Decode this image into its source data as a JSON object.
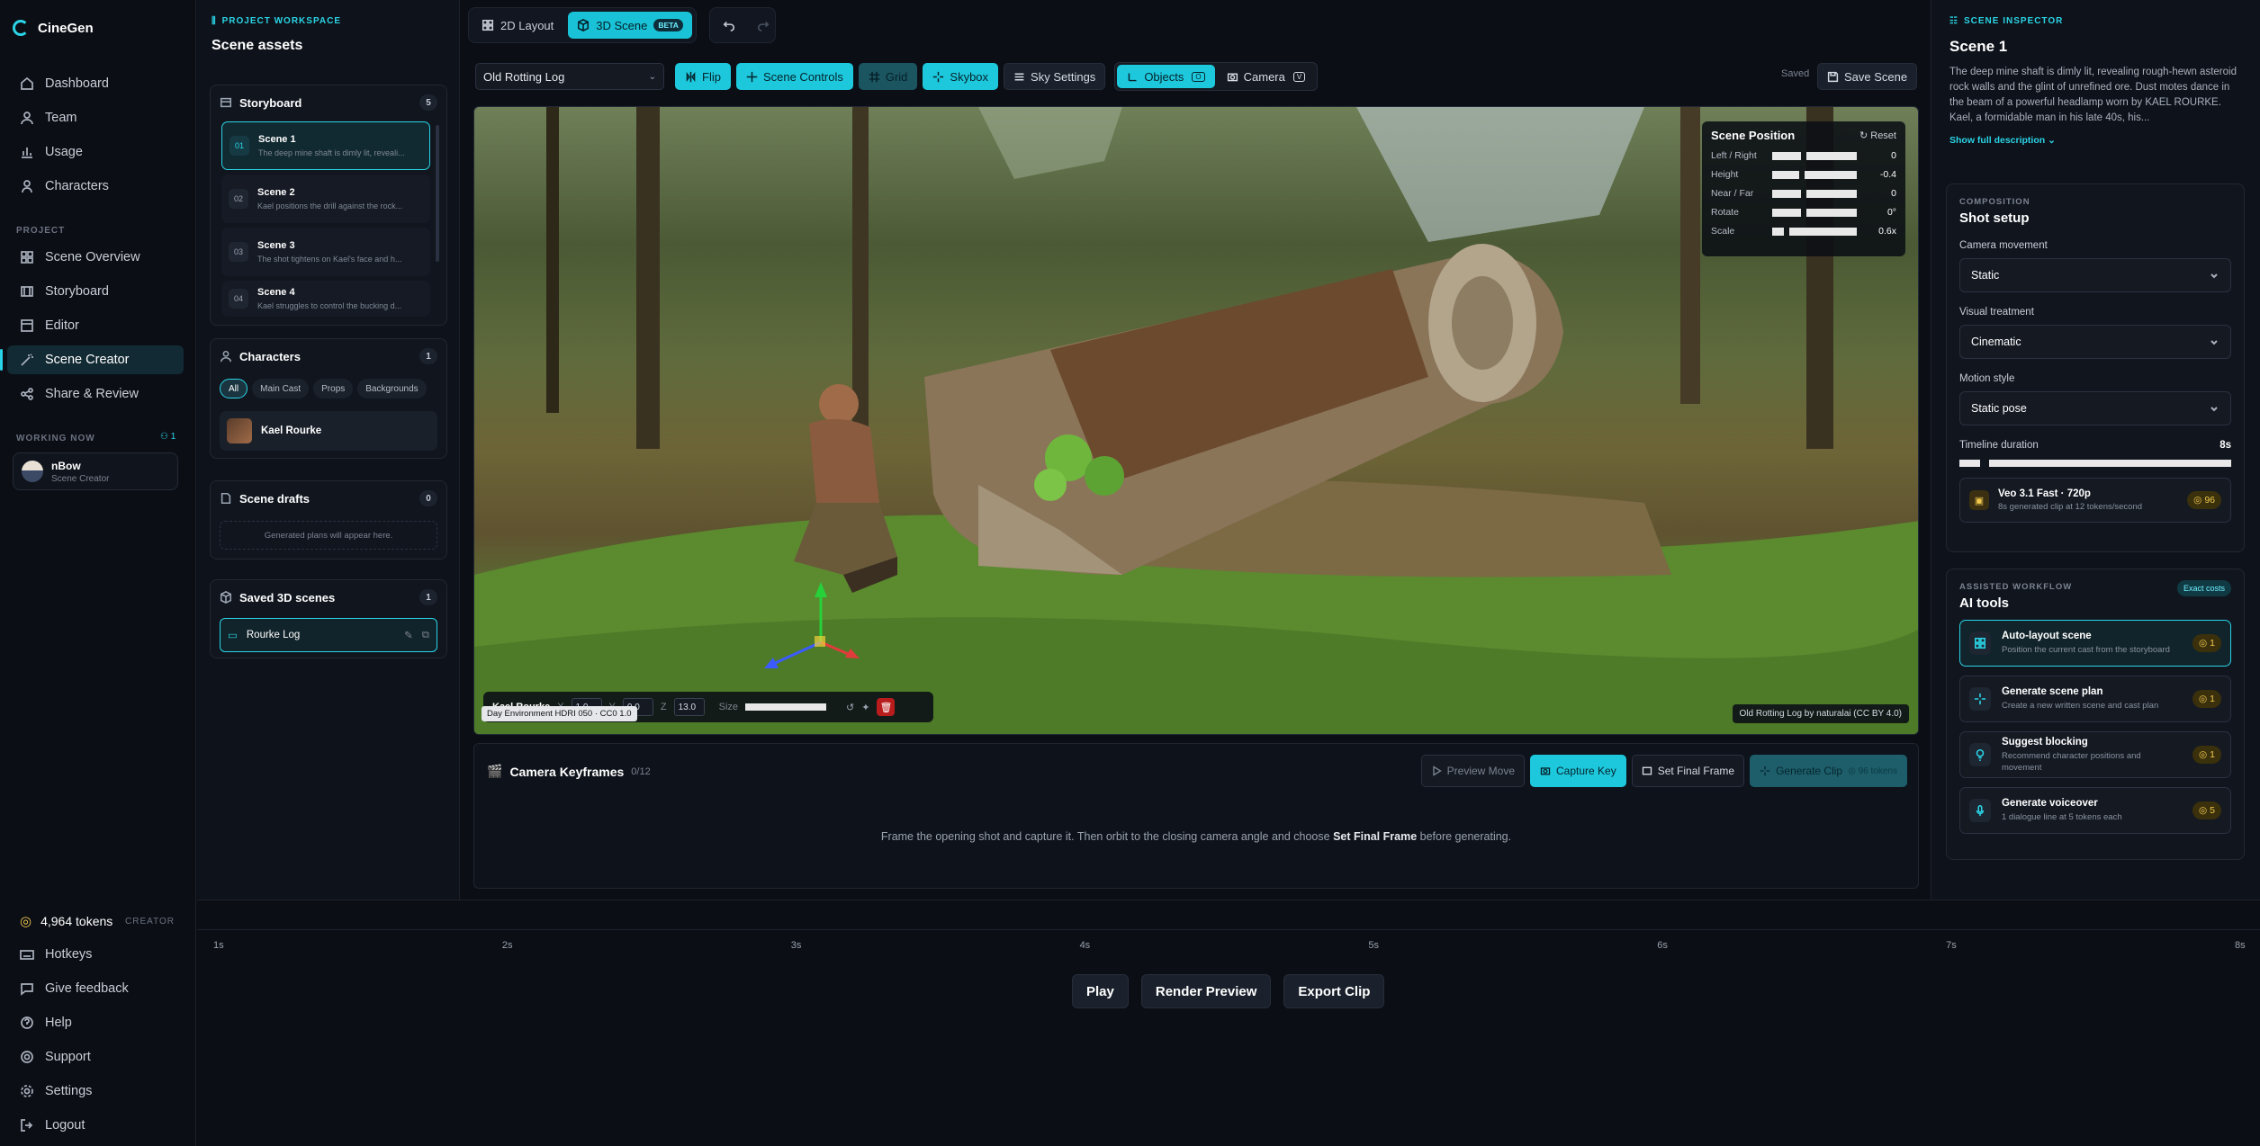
{
  "app": {
    "name": "CineGen"
  },
  "nav": {
    "items": [
      {
        "label": "Dashboard",
        "icon": "home-icon"
      },
      {
        "label": "Team",
        "icon": "users-icon"
      },
      {
        "label": "Usage",
        "icon": "chart-icon"
      },
      {
        "label": "Characters",
        "icon": "user-icon"
      }
    ],
    "project_label": "PROJECT",
    "project_items": [
      {
        "label": "Scene Overview",
        "icon": "grid-icon"
      },
      {
        "label": "Storyboard",
        "icon": "film-icon"
      },
      {
        "label": "Editor",
        "icon": "edit-icon"
      },
      {
        "label": "Scene Creator",
        "icon": "wand-icon"
      },
      {
        "label": "Share & Review",
        "icon": "share-icon"
      }
    ],
    "working_now_label": "WORKING NOW",
    "working_count": "1",
    "user": {
      "name": "nBow",
      "role": "Scene Creator"
    },
    "tokens": "4,964 tokens",
    "tier": "CREATOR",
    "footer_items": [
      {
        "label": "Hotkeys",
        "icon": "keyboard-icon"
      },
      {
        "label": "Give feedback",
        "icon": "message-icon"
      },
      {
        "label": "Help",
        "icon": "help-icon"
      },
      {
        "label": "Support",
        "icon": "support-icon"
      },
      {
        "label": "Settings",
        "icon": "gear-icon"
      },
      {
        "label": "Logout",
        "icon": "logout-icon"
      }
    ]
  },
  "assets": {
    "eyebrow": "PROJECT WORKSPACE",
    "title": "Scene assets",
    "storyboard": {
      "title": "Storyboard",
      "count": "5",
      "scenes": [
        {
          "num": "01",
          "title": "Scene 1",
          "desc": "The deep mine shaft is dimly lit, reveali..."
        },
        {
          "num": "02",
          "title": "Scene 2",
          "desc": "Kael positions the drill against the rock..."
        },
        {
          "num": "03",
          "title": "Scene 3",
          "desc": "The shot tightens on Kael's face and h..."
        },
        {
          "num": "04",
          "title": "Scene 4",
          "desc": "Kael struggles to control the bucking d..."
        }
      ]
    },
    "characters": {
      "title": "Characters",
      "count": "1",
      "filters": [
        "All",
        "Main Cast",
        "Props",
        "Backgrounds"
      ],
      "items": [
        {
          "name": "Kael Rourke"
        }
      ]
    },
    "drafts": {
      "title": "Scene drafts",
      "count": "0",
      "empty": "Generated plans will appear here."
    },
    "saved": {
      "title": "Saved 3D scenes",
      "count": "1",
      "items": [
        {
          "name": "Rourke Log"
        }
      ]
    }
  },
  "topbar": {
    "layout2d": "2D Layout",
    "scene3d": "3D Scene",
    "beta": "BETA"
  },
  "toolbar": {
    "object_select": "Old Rotting Log",
    "flip": "Flip",
    "scene_controls": "Scene Controls",
    "grid": "Grid",
    "skybox": "Skybox",
    "sky_settings": "Sky Settings",
    "objects": "Objects",
    "objects_key": "O",
    "camera": "Camera",
    "camera_key": "V",
    "saved": "Saved",
    "save_scene": "Save Scene"
  },
  "viewport": {
    "position_panel": {
      "title": "Scene Position",
      "reset": "Reset",
      "rows": [
        {
          "label": "Left / Right",
          "value": "0",
          "fill": 0.5
        },
        {
          "label": "Height",
          "value": "-0.4",
          "fill": 0.45
        },
        {
          "label": "Near / Far",
          "value": "0",
          "fill": 0.5
        },
        {
          "label": "Rotate",
          "value": "0°",
          "fill": 0.5
        },
        {
          "label": "Scale",
          "value": "0.6x",
          "fill": 0.06
        }
      ]
    },
    "selection": {
      "name": "Kael Rourke",
      "x_label": "X",
      "x": "1.0",
      "y_label": "Y",
      "y": "0.0",
      "z_label": "Z",
      "z": "13.0",
      "size_label": "Size"
    },
    "tooltip": "Day Environment HDRI 050 · CC0 1.0",
    "credit": "Old Rotting Log by naturalai (CC BY 4.0)"
  },
  "keyframes": {
    "title": "Camera Keyframes",
    "count": "0/12",
    "preview": "Preview Move",
    "capture": "Capture Key",
    "set_final": "Set Final Frame",
    "generate": "Generate Clip",
    "generate_cost": "96 tokens",
    "message_a": "Frame the opening shot and capture it. Then orbit to the closing camera angle and choose ",
    "message_b": "Set Final Frame",
    "message_c": " before generating."
  },
  "inspector": {
    "eyebrow": "SCENE INSPECTOR",
    "title": "Scene 1",
    "description": "The deep mine shaft is dimly lit, revealing rough-hewn asteroid rock walls and the glint of unrefined ore. Dust motes dance in the beam of a powerful headlamp worn by KAEL ROURKE. Kael, a formidable man in his late 40s, his...",
    "show_more": "Show full description",
    "composition": {
      "eyebrow": "COMPOSITION",
      "title": "Shot setup",
      "camera_label": "Camera movement",
      "camera": "Static",
      "visual_label": "Visual treatment",
      "visual": "Cinematic",
      "motion_label": "Motion style",
      "motion": "Static pose",
      "duration_label": "Timeline duration",
      "duration": "8s",
      "duration_fill": 0.25,
      "model": {
        "name": "Veo 3.1 Fast · 720p",
        "desc": "8s generated clip at 12 tokens/second",
        "cost": "96"
      }
    },
    "workflow": {
      "eyebrow": "ASSISTED WORKFLOW",
      "title": "AI tools",
      "badge": "Exact costs",
      "tools": [
        {
          "name": "Auto-layout scene",
          "desc": "Position the current cast from the storyboard",
          "cost": "1",
          "icon": "layout-icon"
        },
        {
          "name": "Generate scene plan",
          "desc": "Create a new written scene and cast plan",
          "cost": "1",
          "icon": "sparkle-icon"
        },
        {
          "name": "Suggest blocking",
          "desc": "Recommend character positions and movement",
          "cost": "1",
          "icon": "bulb-icon"
        },
        {
          "name": "Generate voiceover",
          "desc": "1 dialogue line at 5 tokens each",
          "cost": "5",
          "icon": "mic-icon"
        }
      ]
    }
  },
  "timeline": {
    "ticks": [
      "1s",
      "2s",
      "3s",
      "4s",
      "5s",
      "6s",
      "7s",
      "8s"
    ],
    "play": "Play",
    "render": "Render Preview",
    "export": "Export Clip"
  },
  "colors": {
    "accent": "#1ec8dc",
    "bg": "#0b0e15",
    "panel": "#0e121a",
    "token_gold": "#f2c94c"
  }
}
